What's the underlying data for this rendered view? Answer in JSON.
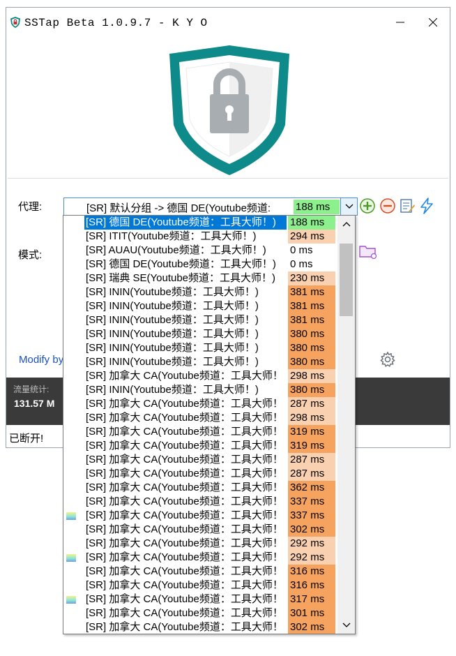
{
  "window": {
    "title": "SSTap Beta 1.0.9.7 - K Y O"
  },
  "form": {
    "proxy_label": "代理:",
    "mode_label": "模式:",
    "selected_proxy": "[SR] 默认分组 -> 德国 DE(Youtube频道:",
    "selected_ping": "188 ms"
  },
  "footer": {
    "modify_link": "Modify by",
    "stats_label": "流量统计:",
    "stats_value": "131.57 M",
    "status": "已断开!"
  },
  "colors": {
    "accent": "#0078d7",
    "shield": "#0e8a8a",
    "ping_fast": "#8cf08c",
    "ping_medium": "#f9d0b0",
    "ping_slow": "#f6a35f"
  },
  "dropdown": {
    "items": [
      {
        "label": "[SR] 德国 DE(Youtube频道：工具大师！)",
        "ping": "188 ms",
        "level": "green",
        "selected": true,
        "badge": false
      },
      {
        "label": "[SR] ITIT(Youtube频道：工具大师！)",
        "ping": "294 ms",
        "level": "light",
        "selected": false,
        "badge": false
      },
      {
        "label": "[SR] AUAU(Youtube频道：工具大师！)",
        "ping": "0 ms",
        "level": "none",
        "selected": false,
        "badge": false
      },
      {
        "label": "[SR] 德国 DE(Youtube频道：工具大师！)",
        "ping": "0 ms",
        "level": "none",
        "selected": false,
        "badge": false
      },
      {
        "label": "[SR] 瑞典 SE(Youtube频道：工具大师！)",
        "ping": "230 ms",
        "level": "light",
        "selected": false,
        "badge": false
      },
      {
        "label": "[SR] ININ(Youtube频道：工具大师！)",
        "ping": "381 ms",
        "level": "orange",
        "selected": false,
        "badge": false
      },
      {
        "label": "[SR] ININ(Youtube频道：工具大师！)",
        "ping": "381 ms",
        "level": "orange",
        "selected": false,
        "badge": false
      },
      {
        "label": "[SR] ININ(Youtube频道：工具大师！)",
        "ping": "381 ms",
        "level": "orange",
        "selected": false,
        "badge": false
      },
      {
        "label": "[SR] ININ(Youtube频道：工具大师！)",
        "ping": "380 ms",
        "level": "orange",
        "selected": false,
        "badge": false
      },
      {
        "label": "[SR] ININ(Youtube频道：工具大师！)",
        "ping": "380 ms",
        "level": "orange",
        "selected": false,
        "badge": false
      },
      {
        "label": "[SR] ININ(Youtube频道：工具大师！)",
        "ping": "380 ms",
        "level": "orange",
        "selected": false,
        "badge": false
      },
      {
        "label": "[SR] 加拿大 CA(Youtube频道：工具大师！",
        "ping": "298 ms",
        "level": "light",
        "selected": false,
        "badge": false
      },
      {
        "label": "[SR] ININ(Youtube频道：工具大师！)",
        "ping": "380 ms",
        "level": "orange",
        "selected": false,
        "badge": false
      },
      {
        "label": "[SR] 加拿大 CA(Youtube频道：工具大师！",
        "ping": "287 ms",
        "level": "light",
        "selected": false,
        "badge": false
      },
      {
        "label": "[SR] 加拿大 CA(Youtube频道：工具大师！",
        "ping": "298 ms",
        "level": "light",
        "selected": false,
        "badge": false
      },
      {
        "label": "[SR] 加拿大 CA(Youtube频道：工具大师！",
        "ping": "319 ms",
        "level": "orange",
        "selected": false,
        "badge": false
      },
      {
        "label": "[SR] 加拿大 CA(Youtube频道：工具大师！",
        "ping": "319 ms",
        "level": "orange",
        "selected": false,
        "badge": false
      },
      {
        "label": "[SR] 加拿大 CA(Youtube频道：工具大师！",
        "ping": "287 ms",
        "level": "light",
        "selected": false,
        "badge": false
      },
      {
        "label": "[SR] 加拿大 CA(Youtube频道：工具大师！",
        "ping": "287 ms",
        "level": "light",
        "selected": false,
        "badge": false
      },
      {
        "label": "[SR] 加拿大 CA(Youtube频道：工具大师！",
        "ping": "362 ms",
        "level": "orange",
        "selected": false,
        "badge": false
      },
      {
        "label": "[SR] 加拿大 CA(Youtube频道：工具大师！",
        "ping": "337 ms",
        "level": "orange",
        "selected": false,
        "badge": false
      },
      {
        "label": "[SR] 加拿大 CA(Youtube频道：工具大师！",
        "ping": "337 ms",
        "level": "orange",
        "selected": false,
        "badge": true
      },
      {
        "label": "[SR] 加拿大 CA(Youtube频道：工具大师！",
        "ping": "302 ms",
        "level": "orange",
        "selected": false,
        "badge": false
      },
      {
        "label": "[SR] 加拿大 CA(Youtube频道：工具大师！",
        "ping": "292 ms",
        "level": "light",
        "selected": false,
        "badge": false
      },
      {
        "label": "[SR] 加拿大 CA(Youtube频道：工具大师！",
        "ping": "292 ms",
        "level": "light",
        "selected": false,
        "badge": true
      },
      {
        "label": "[SR] 加拿大 CA(Youtube频道：工具大师！",
        "ping": "316 ms",
        "level": "orange",
        "selected": false,
        "badge": false
      },
      {
        "label": "[SR] 加拿大 CA(Youtube频道：工具大师！",
        "ping": "316 ms",
        "level": "orange",
        "selected": false,
        "badge": false
      },
      {
        "label": "[SR] 加拿大 CA(Youtube频道：工具大师！",
        "ping": "317 ms",
        "level": "orange",
        "selected": false,
        "badge": true
      },
      {
        "label": "[SR] 加拿大 CA(Youtube频道：工具大师！",
        "ping": "301 ms",
        "level": "orange",
        "selected": false,
        "badge": false
      },
      {
        "label": "[SR] 加拿大 CA(Youtube频道：工具大师！",
        "ping": "302 ms",
        "level": "orange",
        "selected": false,
        "badge": false
      }
    ]
  }
}
